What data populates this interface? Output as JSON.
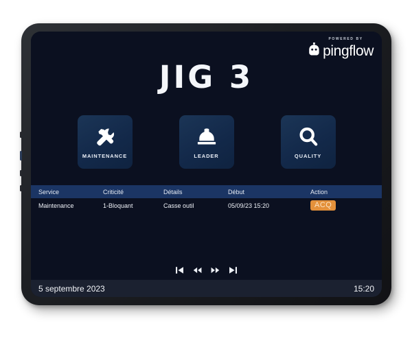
{
  "brand": {
    "powered_by": "POWERED BY",
    "name": "pingflow",
    "mascot_icon": "pingflow-mascot-icon"
  },
  "header": {
    "title": "JIG 3"
  },
  "tiles": [
    {
      "label": "MAINTENANCE",
      "icon": "wrench-screwdriver-icon"
    },
    {
      "label": "LEADER",
      "icon": "hard-hat-icon"
    },
    {
      "label": "QUALITY",
      "icon": "magnifying-glass-icon"
    }
  ],
  "table": {
    "columns": [
      "Service",
      "Criticité",
      "Détails",
      "Début",
      "Action"
    ],
    "rows": [
      {
        "service": "Maintenance",
        "criticite": "1-Bloquant",
        "details": "Casse outil",
        "debut": "05/09/23 15:20",
        "action": "ACQ"
      }
    ]
  },
  "pager": {
    "first": "skip-to-first-icon",
    "prev": "rewind-icon",
    "next": "fast-forward-icon",
    "last": "skip-to-last-icon"
  },
  "footer": {
    "date": "5 septembre 2023",
    "time": "15:20"
  },
  "colors": {
    "screen_background": "#0b1020",
    "tile_background": "#13294a",
    "table_header": "#1b3564",
    "footer_background": "#1b2130",
    "critical_red": "#d8302c",
    "badge_orange": "#e4913b",
    "text_primary": "#eef1f7"
  }
}
